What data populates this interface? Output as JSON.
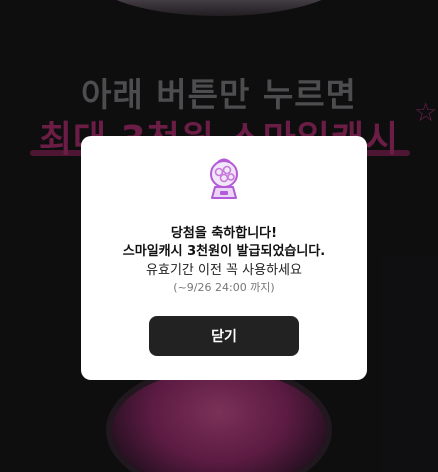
{
  "background": {
    "headline": "아래 버튼만 누르면",
    "highlight": "최대 3천원 스마일캐시"
  },
  "modal": {
    "icon": "gumball-machine-icon",
    "title": "당첨을 축하합니다!",
    "line2": "스마일캐시 3천원이 발급되었습니다.",
    "line3": "유효기간 이전 꼭 사용하세요",
    "note": "(~9/26 24:00 까지)",
    "close_label": "닫기"
  },
  "colors": {
    "accent": "#c4367f",
    "icon_purple": "#b45ad6",
    "button_dark": "#222222"
  }
}
